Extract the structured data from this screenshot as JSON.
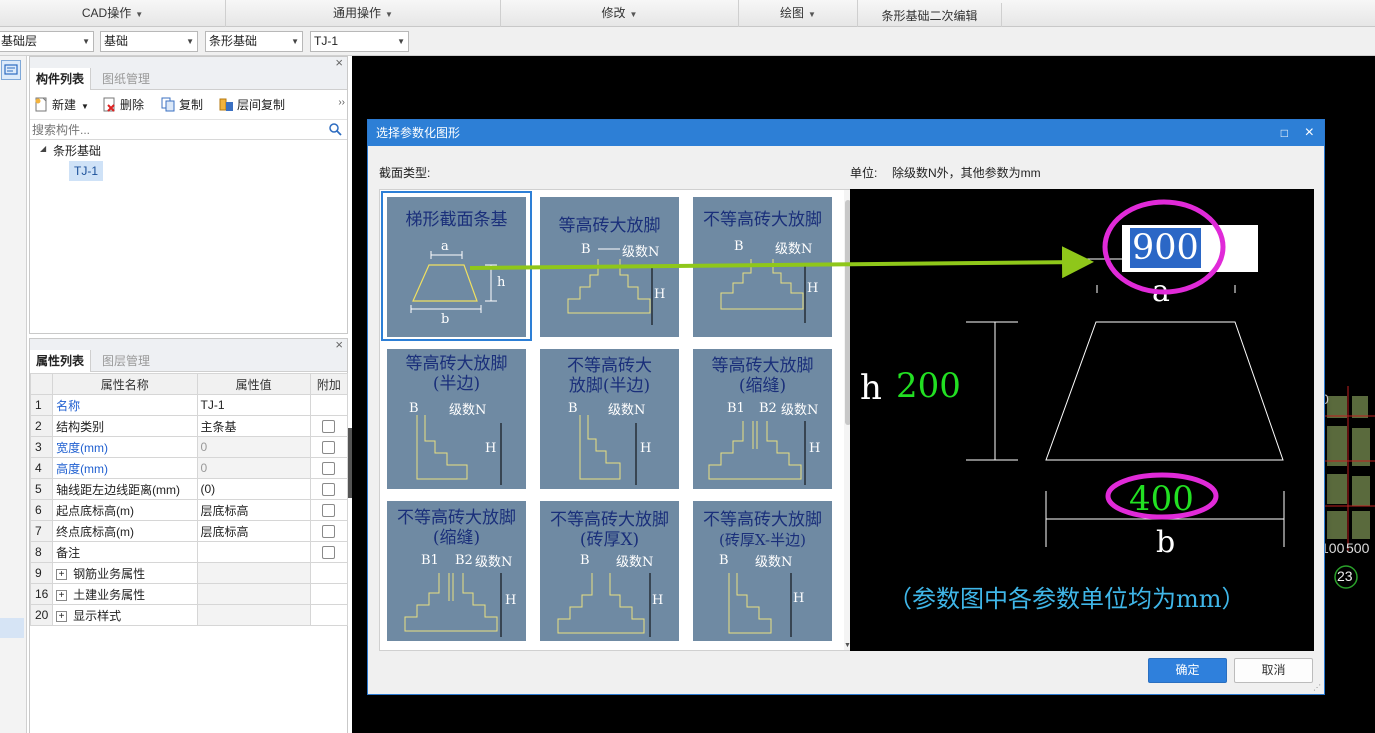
{
  "menubar": {
    "items": [
      {
        "label": "CAD操作",
        "arrow": "▼"
      },
      {
        "label": "通用操作",
        "arrow": "▼"
      },
      {
        "label": "修改",
        "arrow": "▼"
      },
      {
        "label": "绘图",
        "arrow": "▼"
      },
      {
        "label": "条形基础二次编辑",
        "arrow": ""
      }
    ]
  },
  "combobar": {
    "floor": "基础层",
    "category": "基础",
    "type": "条形基础",
    "component": "TJ-1"
  },
  "component_panel": {
    "tab_active": "构件列表",
    "tab_inactive": "图纸管理",
    "close": "×",
    "toolbar": {
      "new": "新建",
      "delete": "删除",
      "copy": "复制",
      "floor_copy": "层间复制",
      "more": "››"
    },
    "search_placeholder": "搜索构件...",
    "tree": {
      "root": "条形基础",
      "child": "TJ-1",
      "toggle": "◢"
    }
  },
  "property_panel": {
    "tab_active": "属性列表",
    "tab_inactive": "图层管理",
    "close": "×",
    "headers": [
      "属性名称",
      "属性值",
      "附加"
    ],
    "rows": [
      {
        "num": "1",
        "name": "名称",
        "value": "TJ-1"
      },
      {
        "num": "2",
        "name": "结构类别",
        "value": "主条基"
      },
      {
        "num": "3",
        "name": "宽度(mm)",
        "value": "0"
      },
      {
        "num": "4",
        "name": "高度(mm)",
        "value": "0"
      },
      {
        "num": "5",
        "name": "轴线距左边线距离(mm)",
        "value": "(0)"
      },
      {
        "num": "6",
        "name": "起点底标高(m)",
        "value": "层底标高"
      },
      {
        "num": "7",
        "name": "终点底标高(m)",
        "value": "层底标高"
      },
      {
        "num": "8",
        "name": "备注",
        "value": ""
      },
      {
        "num": "9",
        "name": "钢筋业务属性",
        "value": ""
      },
      {
        "num": "16",
        "name": "土建业务属性",
        "value": ""
      },
      {
        "num": "20",
        "name": "显示样式",
        "value": ""
      }
    ]
  },
  "cad": {
    "labels": [
      "0",
      "100",
      "500",
      "23"
    ]
  },
  "dialog": {
    "title": "选择参数化图形",
    "maximize": "□",
    "close": "×",
    "section_type_label": "截面类型:",
    "unit_label": "单位:",
    "unit_text": "除级数N外，其他参数为mm",
    "shapes": [
      {
        "l1": "梯形截面条基",
        "l2": ""
      },
      {
        "l1": "等高砖大放脚",
        "l2": ""
      },
      {
        "l1": "不等高砖大放脚",
        "l2": ""
      },
      {
        "l1": "等高砖大放脚",
        "l2": "(半边)"
      },
      {
        "l1": "不等高砖大",
        "l2": "放脚(半边)"
      },
      {
        "l1": "等高砖大放脚",
        "l2": "(缩缝)"
      },
      {
        "l1": "不等高砖大放脚",
        "l2": "(缩缝)"
      },
      {
        "l1": "不等高砖大放脚",
        "l2": "(砖厚X)"
      },
      {
        "l1": "不等高砖大放脚",
        "l2": "(砖厚X-半边)"
      }
    ],
    "thumb_labels": {
      "a": "a",
      "b": "b",
      "h": "h",
      "B": "B",
      "B1": "B1",
      "B2": "B2",
      "H": "H",
      "N": "级数N"
    },
    "preview": {
      "a_value": "900",
      "a_label": "a",
      "h_label": "h",
      "h_value": "200",
      "b_value": "400",
      "b_label": "b",
      "note": "（参数图中各参数单位均为mm）"
    },
    "ok_button": "确定",
    "cancel_button": "取消"
  }
}
